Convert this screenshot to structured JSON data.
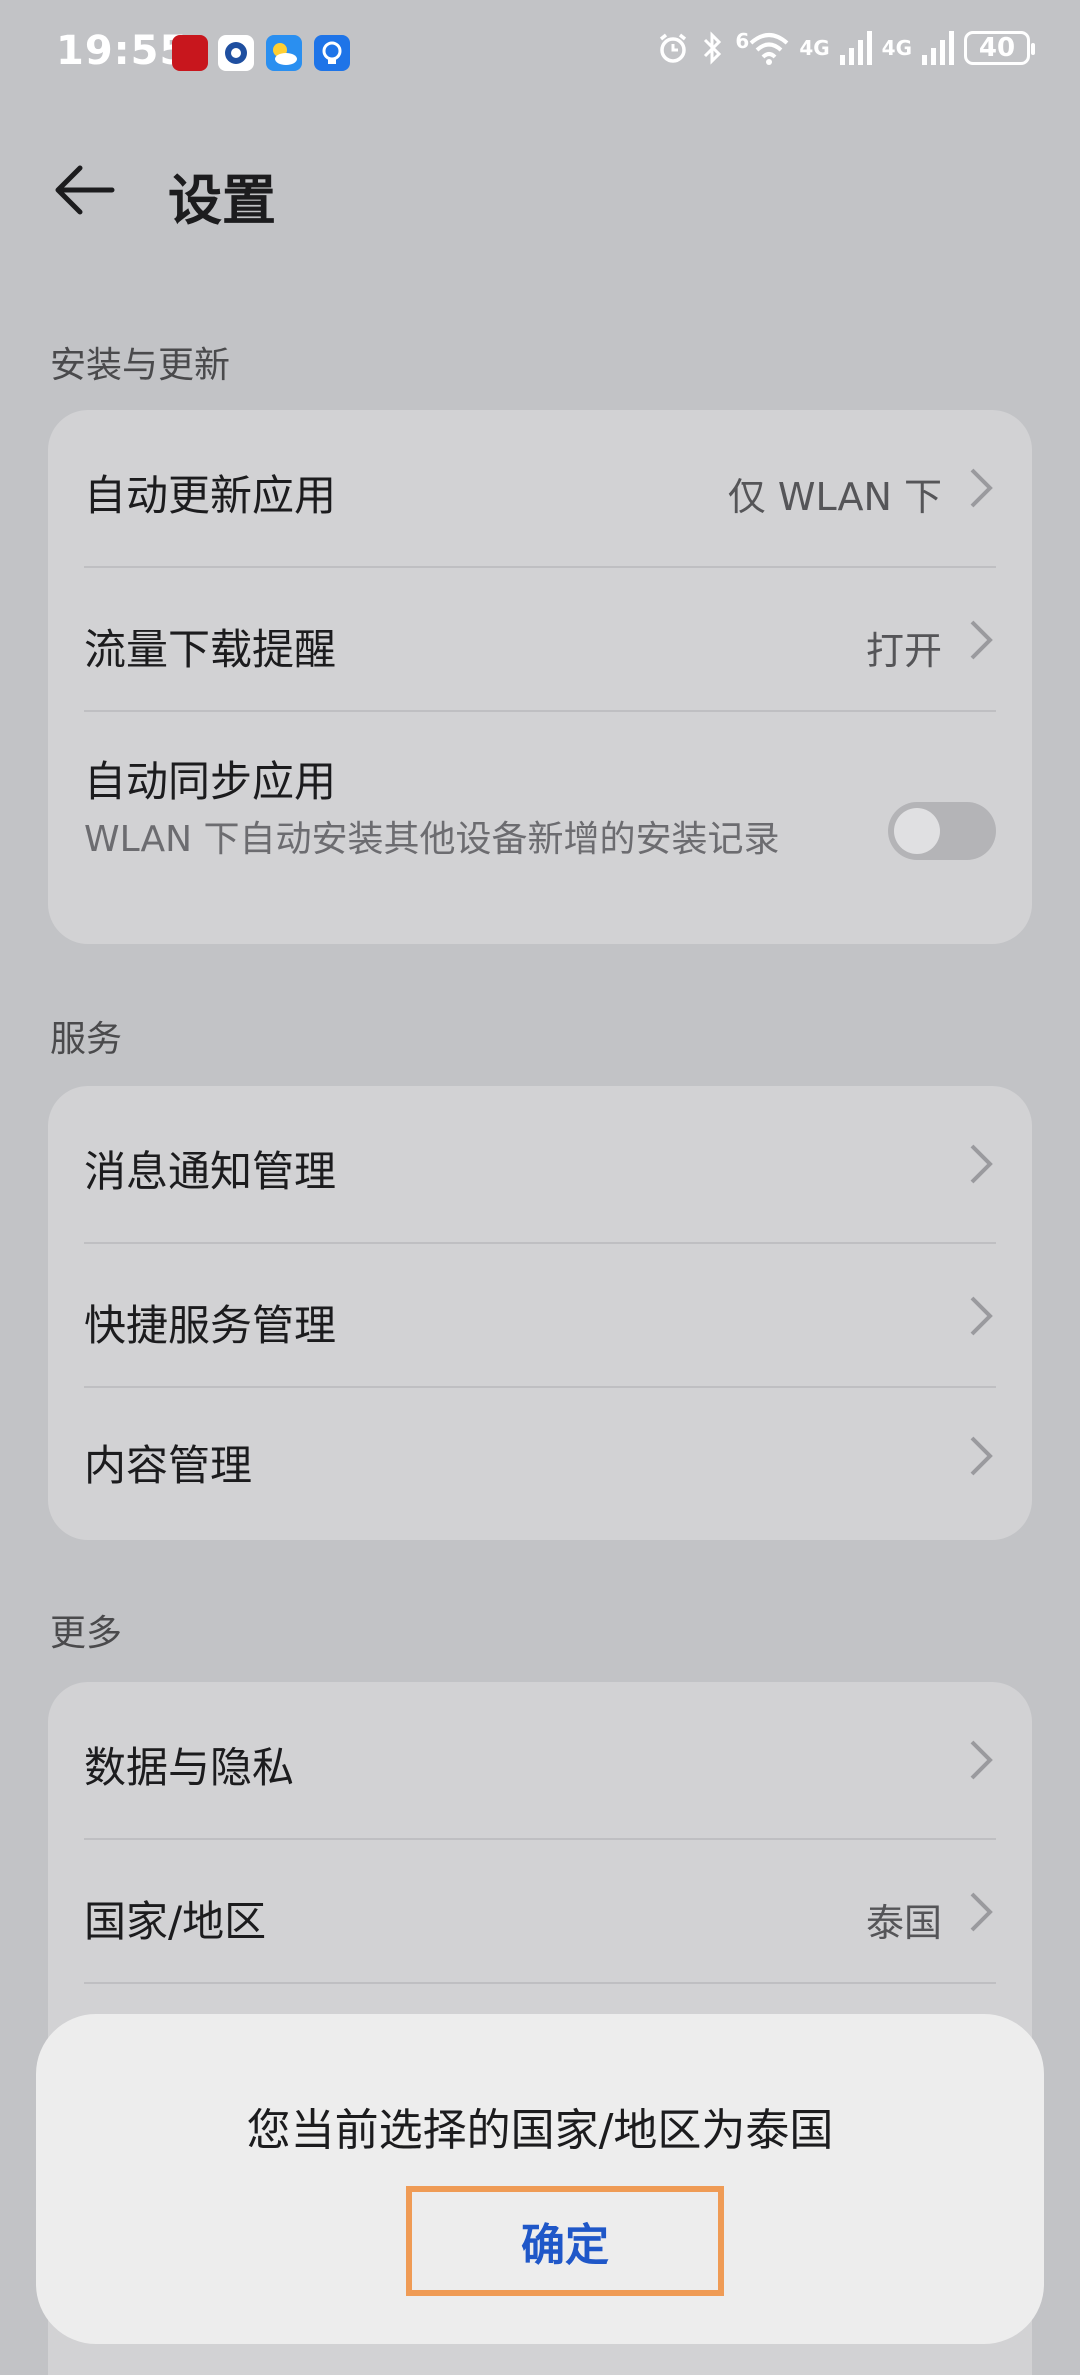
{
  "status_bar": {
    "time": "19:55",
    "wifi_badge": "6",
    "signal1_label": "4G",
    "signal2_label": "4G",
    "battery": "40"
  },
  "header": {
    "title": "设置"
  },
  "sections": {
    "install": {
      "label": "安装与更新",
      "auto_update": {
        "label": "自动更新应用",
        "value": "仅 WLAN 下"
      },
      "data_reminder": {
        "label": "流量下载提醒",
        "value": "打开"
      },
      "auto_sync": {
        "label": "自动同步应用",
        "sub": "WLAN 下自动安装其他设备新增的安装记录",
        "toggle_on": false
      }
    },
    "service": {
      "label": "服务",
      "notifications": {
        "label": "消息通知管理"
      },
      "shortcuts": {
        "label": "快捷服务管理"
      },
      "content": {
        "label": "内容管理"
      }
    },
    "more": {
      "label": "更多",
      "privacy": {
        "label": "数据与隐私"
      },
      "region": {
        "label": "国家/地区",
        "value": "泰国"
      }
    }
  },
  "dialog": {
    "message": "您当前选择的国家/地区为泰国",
    "confirm": "确定"
  },
  "colors": {
    "accent": "#1f57c8",
    "highlight_box": "#ef9b55"
  }
}
